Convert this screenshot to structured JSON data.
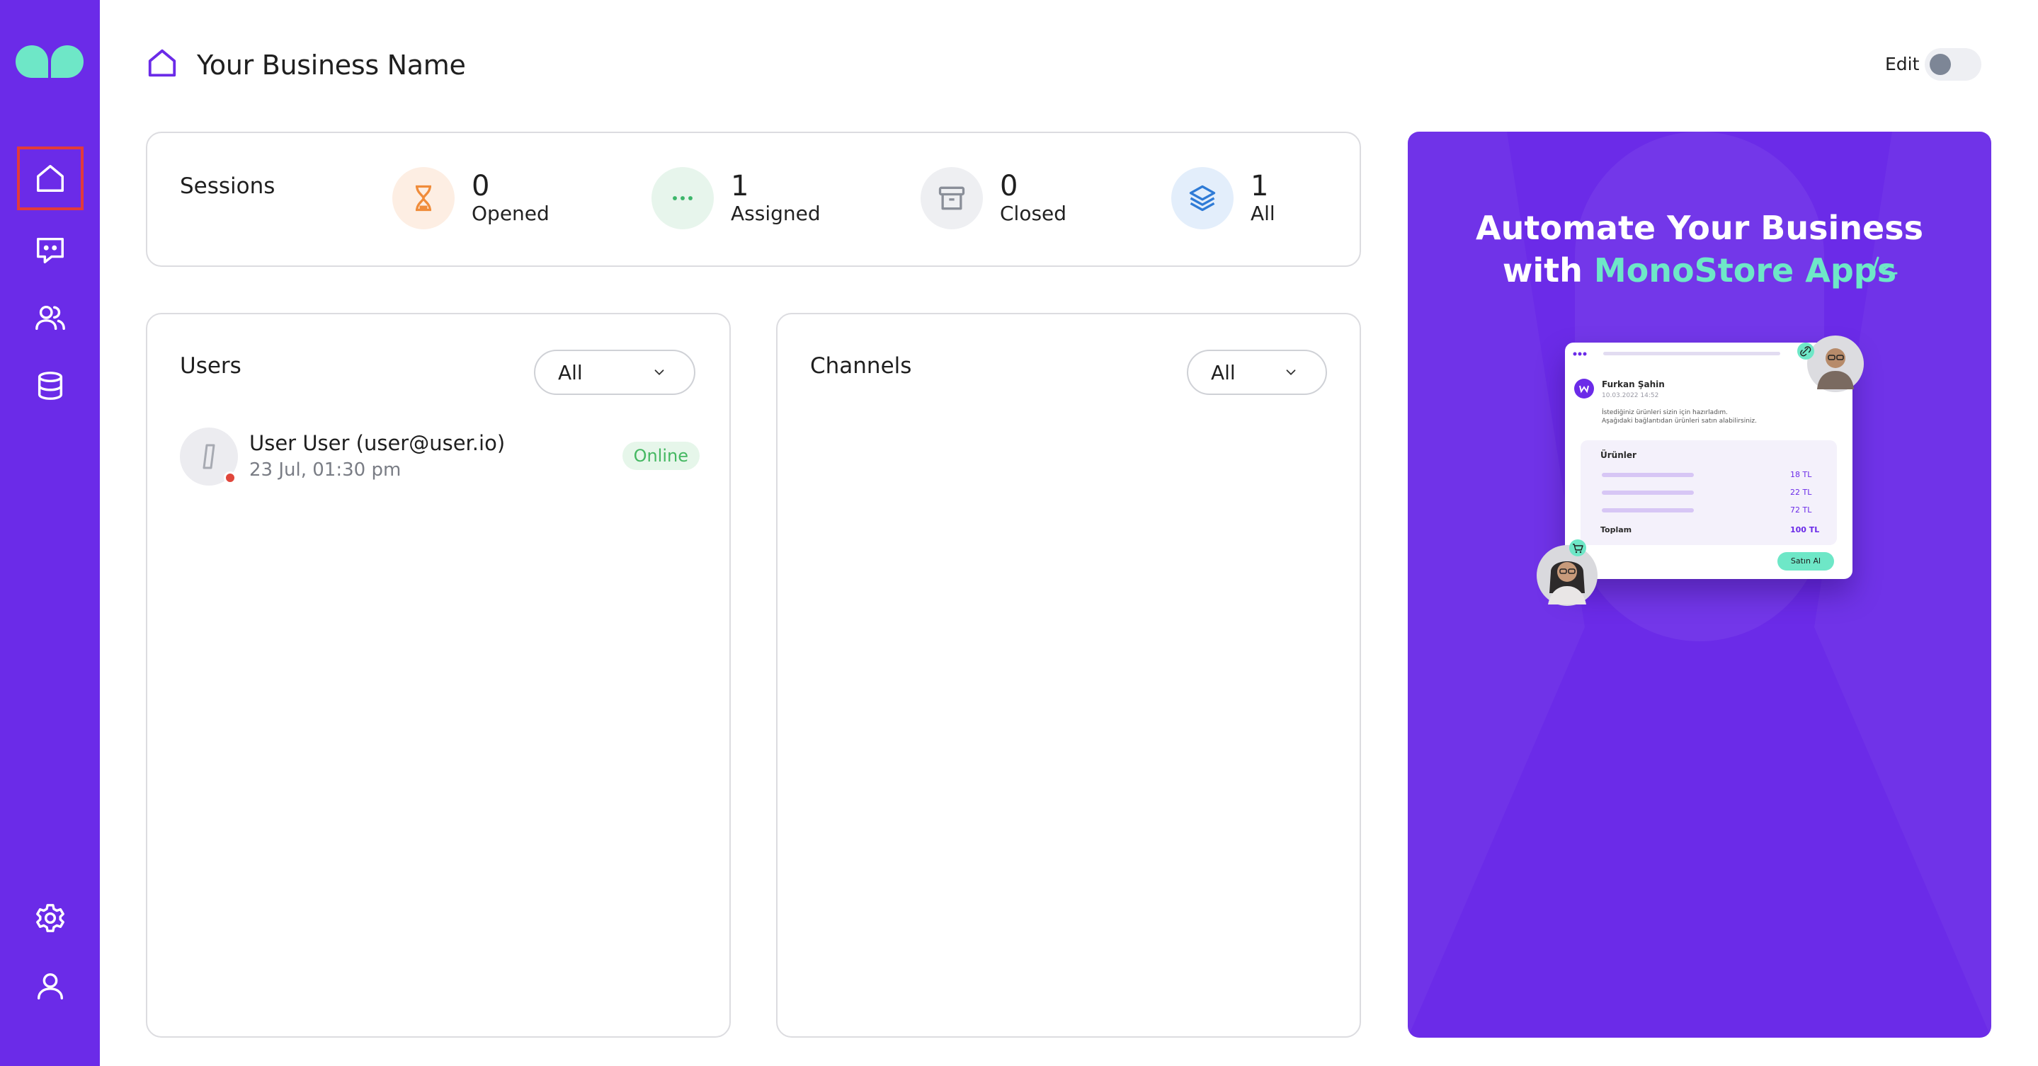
{
  "header": {
    "title": "Your Business Name",
    "edit_label": "Edit",
    "edit_enabled": false
  },
  "sidebar": {
    "items": [
      {
        "name": "home",
        "icon": "home-icon",
        "active": true
      },
      {
        "name": "messages",
        "icon": "chat-icon",
        "active": false
      },
      {
        "name": "users",
        "icon": "users-icon",
        "active": false
      },
      {
        "name": "database",
        "icon": "database-icon",
        "active": false
      },
      {
        "name": "settings",
        "icon": "gear-icon",
        "active": false
      },
      {
        "name": "profile",
        "icon": "user-icon",
        "active": false
      }
    ]
  },
  "sessions": {
    "title": "Sessions",
    "stats": [
      {
        "value": "0",
        "label": "Opened",
        "icon": "hourglass-icon",
        "color": "#f08c3b"
      },
      {
        "value": "1",
        "label": "Assigned",
        "icon": "dots-icon",
        "color": "#3cb66a"
      },
      {
        "value": "0",
        "label": "Closed",
        "icon": "archive-icon",
        "color": "#8a8f99"
      },
      {
        "value": "1",
        "label": "All",
        "icon": "layers-icon",
        "color": "#2f7bd6"
      }
    ]
  },
  "users": {
    "title": "Users",
    "filter": "All",
    "list": [
      {
        "name": "User User (user@user.io)",
        "time": "23 Jul, 01:30 pm",
        "status": "Online"
      }
    ]
  },
  "channels": {
    "title": "Channels",
    "filter": "All"
  },
  "promo": {
    "line1": "Automate Your Business",
    "line2_plain": "with ",
    "line2_accent": "MonoStore Apps",
    "colors": {
      "background": "#6b2be8",
      "accent": "#6ee7c7"
    },
    "mock": {
      "sender": "Furkan Şahin",
      "date": "10.03.2022 14:52",
      "message1": "İstediğiniz ürünleri sizin için hazırladım.",
      "message2": "Aşağıdaki bağlantıdan ürünleri satın alabilirsiniz.",
      "products_title": "Ürünler",
      "prices": [
        "18 TL",
        "22 TL",
        "72 TL"
      ],
      "total_label": "Toplam",
      "total_value": "100 TL",
      "button": "Satın Al"
    }
  },
  "colors": {
    "brand": "#6b2be8",
    "highlight": "#e23b3b",
    "online": "#45b862"
  }
}
